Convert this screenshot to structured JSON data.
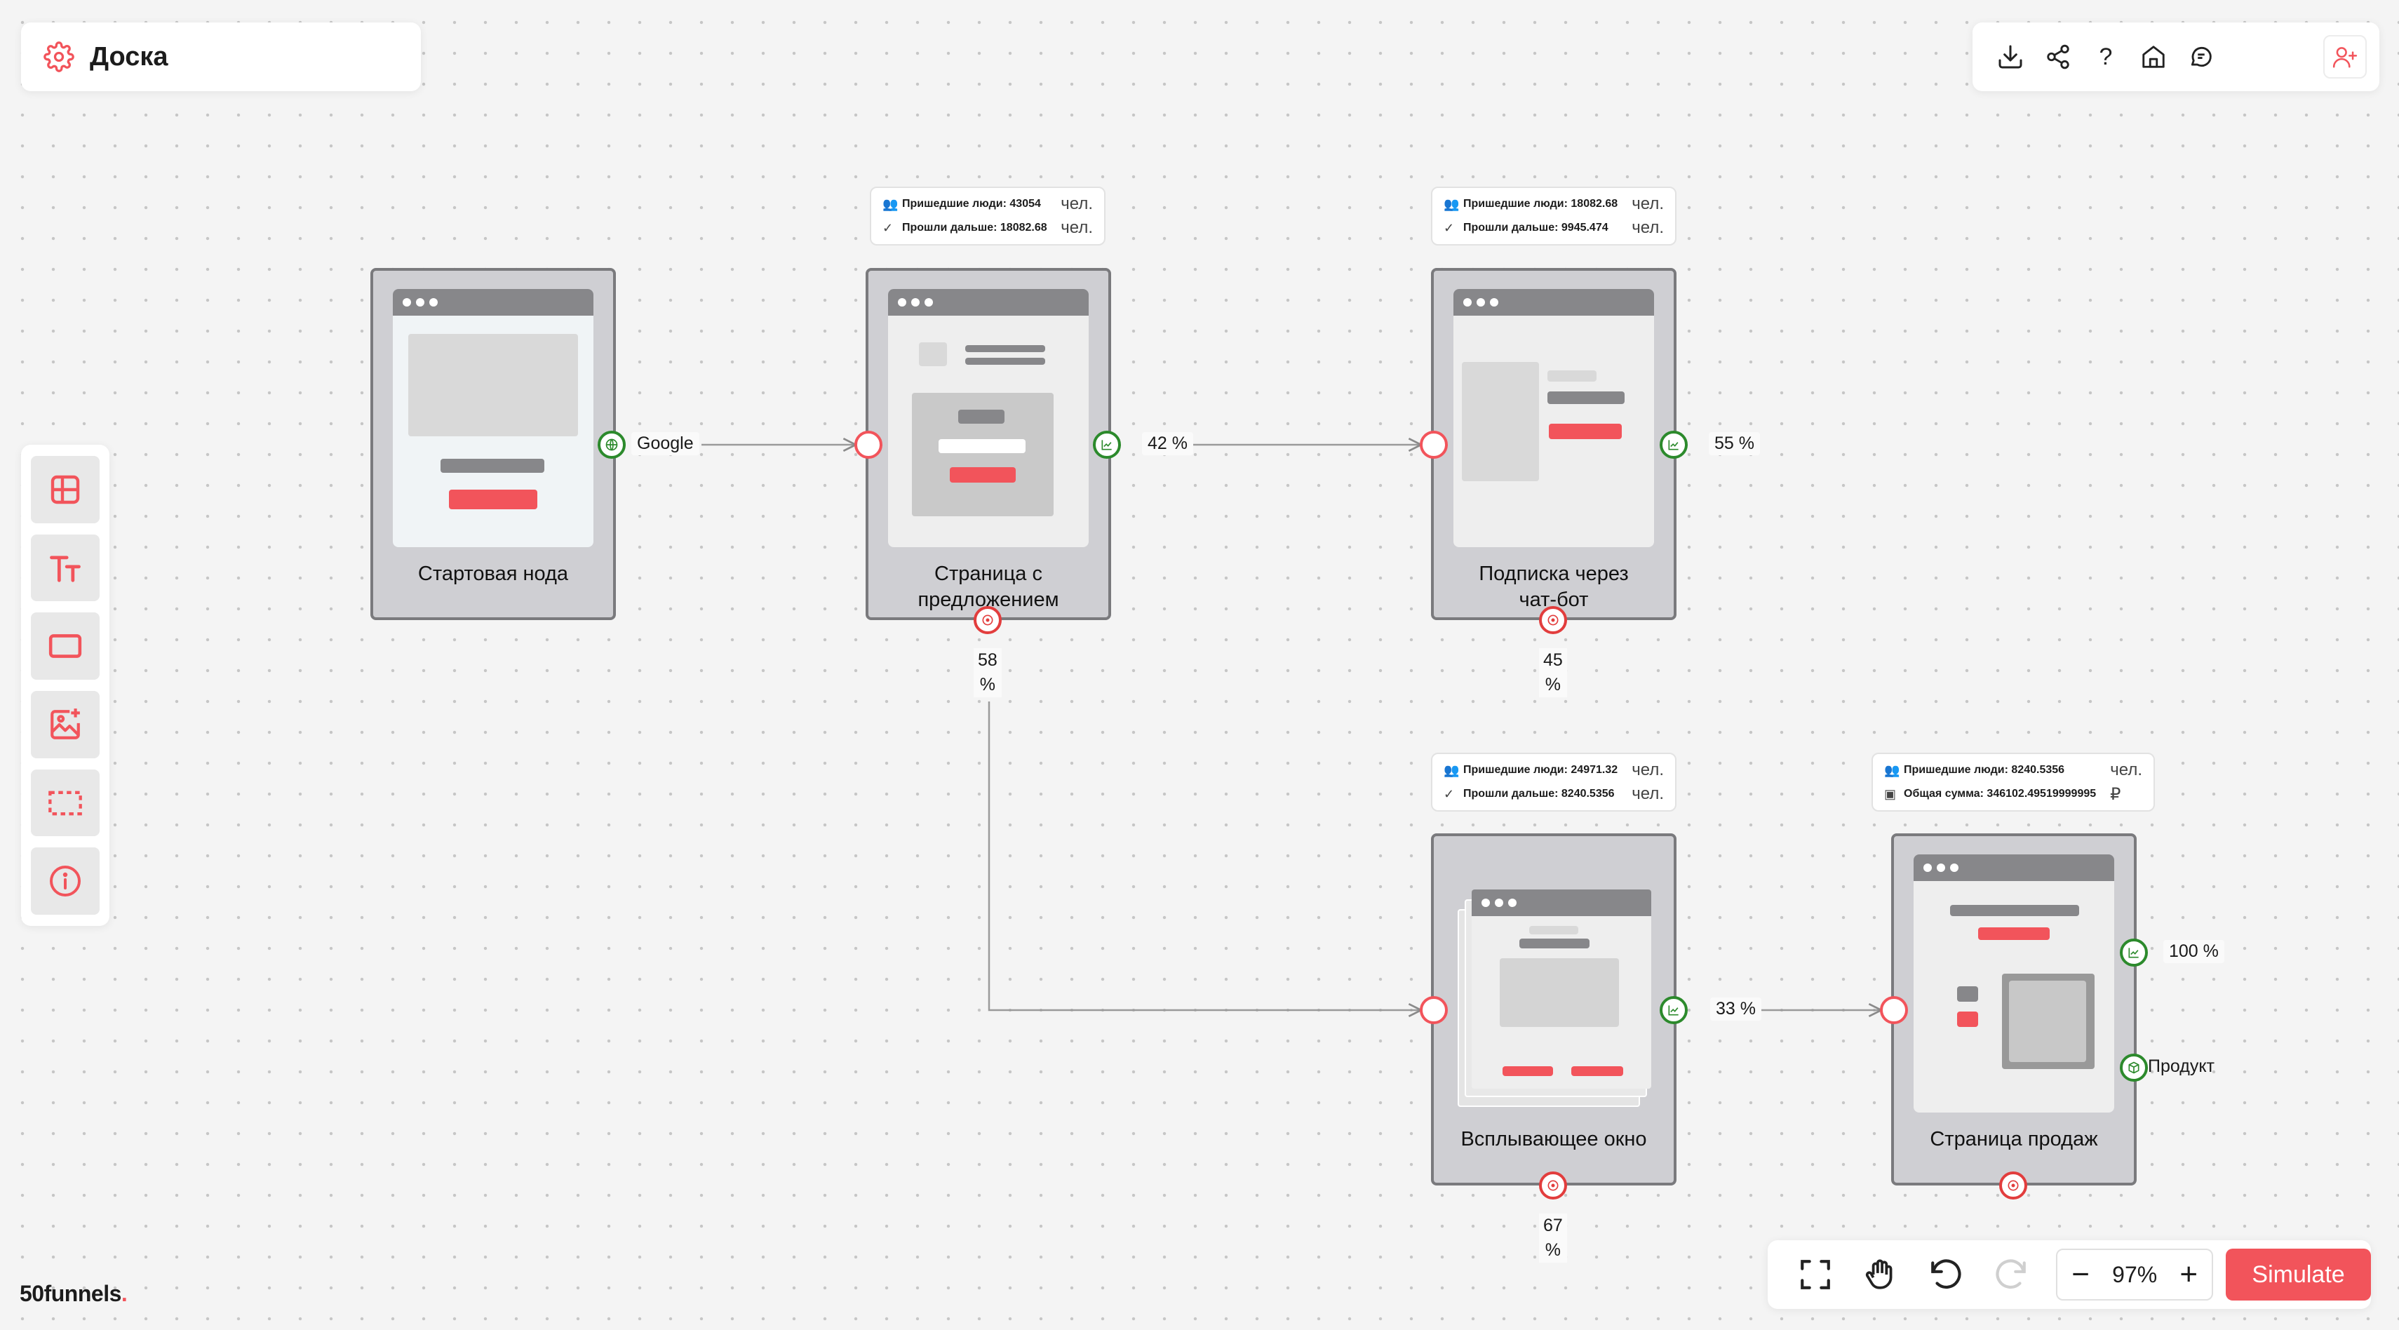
{
  "header": {
    "title": "Доска",
    "settings_icon": "gear-icon"
  },
  "top_toolbar": {
    "items": [
      {
        "name": "download-icon"
      },
      {
        "name": "share-icon"
      },
      {
        "name": "help-icon",
        "label": "?"
      },
      {
        "name": "home-icon"
      },
      {
        "name": "chat-icon"
      }
    ],
    "invite_icon": "add-user-icon"
  },
  "left_toolbar": {
    "items": [
      "layout-icon",
      "text-icon",
      "rectangle-icon",
      "add-image-icon",
      "selection-icon",
      "info-icon"
    ]
  },
  "nodes": [
    {
      "id": "start",
      "label": "Стартовая нода"
    },
    {
      "id": "offer",
      "label": "Страница с предложением"
    },
    {
      "id": "chatbot",
      "label": "Подписка через чат-бот"
    },
    {
      "id": "popup",
      "label": "Всплывающее окно"
    },
    {
      "id": "sales",
      "label": "Страница продаж"
    }
  ],
  "stats": {
    "offer": {
      "row1": "Пришедшие люди: 43054",
      "row2": "Прошли дальше: 18082.68",
      "unit": "чел."
    },
    "chatbot": {
      "row1": "Пришедшие люди: 18082.68",
      "row2": "Прошли дальше: 9945.474",
      "unit": "чел."
    },
    "popup": {
      "row1": "Пришедшие люди: 24971.32",
      "row2": "Прошли дальше: 8240.5356",
      "unit": "чел."
    },
    "sales": {
      "row1": "Пришедшие люди: 8240.5356",
      "row2": "Общая сумма: 346102.49519999995",
      "unit": "чел.",
      "currency": "₽"
    }
  },
  "edges": {
    "google": "Google",
    "offer_next": "42 %",
    "chatbot_next": "55 %",
    "offer_exit": "58",
    "chatbot_exit": "45",
    "popup_next": "33 %",
    "popup_exit": "67",
    "sales_next": "100 %",
    "sales_product": "Продукт",
    "percent_sign": "%"
  },
  "bottom_toolbar": {
    "zoom": "97%",
    "minus": "−",
    "plus": "+",
    "simulate": "Simulate"
  },
  "brand": {
    "name": "50funnels",
    "dot": "."
  },
  "colors": {
    "accent": "#f2545b",
    "success": "#2c8a2c",
    "node_bg": "#cfcfd3"
  }
}
